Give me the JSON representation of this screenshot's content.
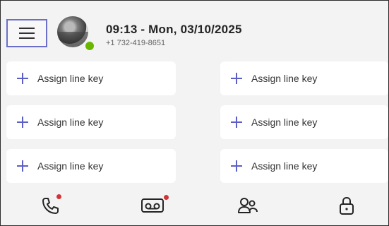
{
  "header": {
    "datetime": "09:13 - Mon, 03/10/2025",
    "phone_number": "+1 732-419-8651",
    "presence": "available"
  },
  "line_keys": [
    {
      "label": "Assign line key",
      "icon": "plus-icon"
    },
    {
      "label": "Assign line key",
      "icon": "plus-icon"
    },
    {
      "label": "Assign line key",
      "icon": "plus-icon"
    },
    {
      "label": "Assign line key",
      "icon": "plus-icon"
    },
    {
      "label": "Assign line key",
      "icon": "plus-icon"
    },
    {
      "label": "Assign line key",
      "icon": "plus-icon"
    }
  ],
  "bottom_nav": [
    {
      "name": "calls",
      "icon": "phone-icon",
      "badge": true
    },
    {
      "name": "voicemail",
      "icon": "voicemail-icon",
      "badge": true
    },
    {
      "name": "people",
      "icon": "people-icon",
      "badge": false
    },
    {
      "name": "lock",
      "icon": "lock-icon",
      "badge": false
    }
  ],
  "colors": {
    "accent": "#5b5fc7",
    "badge": "#d13438",
    "presence": "#6bb700",
    "background": "#f3f3f3",
    "card": "#ffffff"
  }
}
